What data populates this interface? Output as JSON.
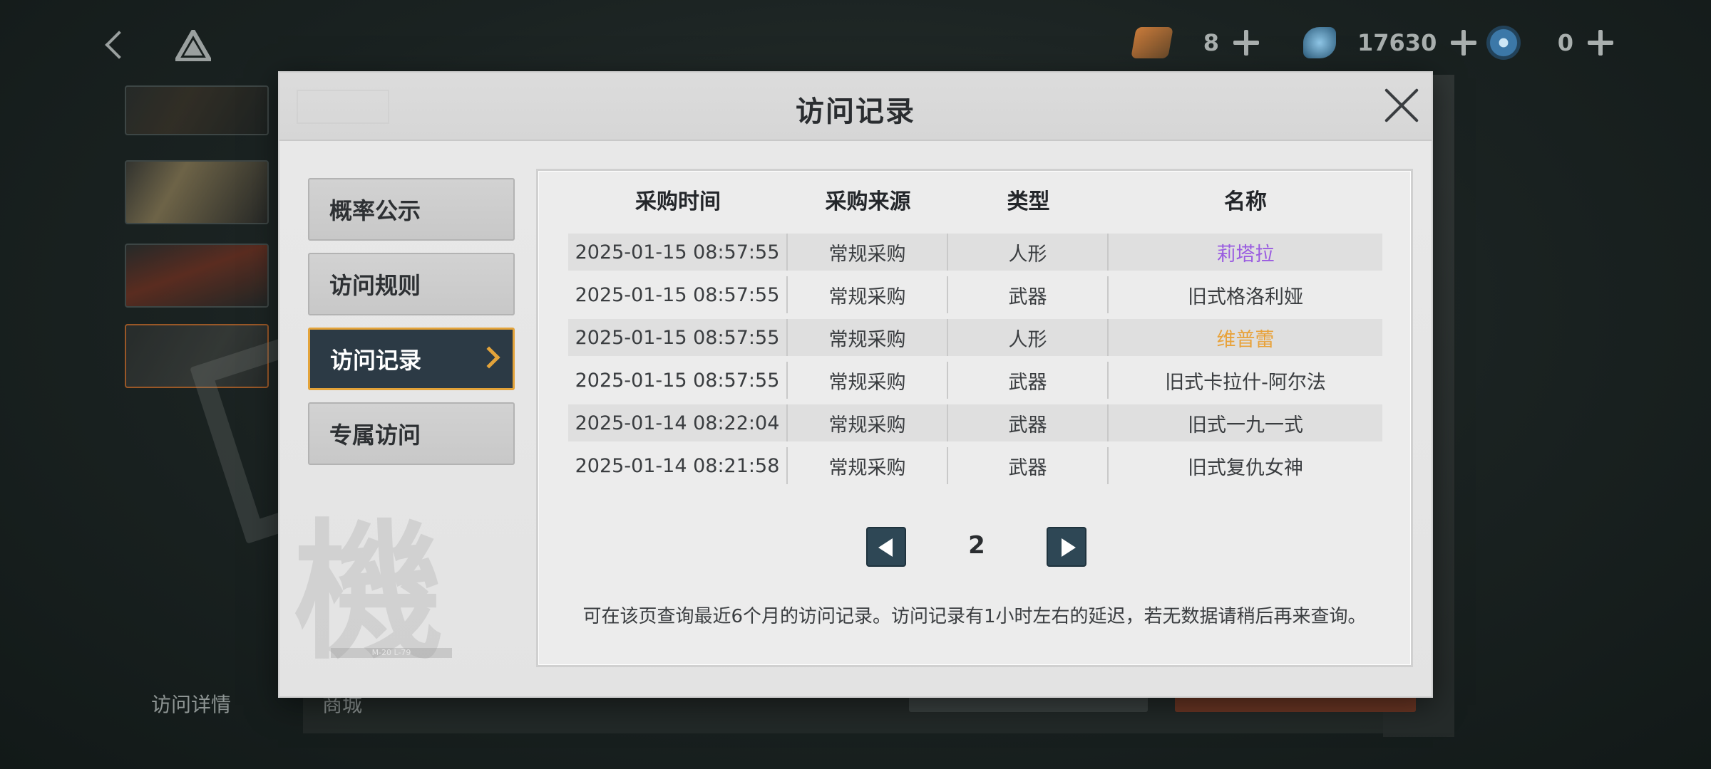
{
  "currencies": [
    {
      "icon": "ticket-icon",
      "value": "8"
    },
    {
      "icon": "crystal-icon",
      "value": "17630"
    },
    {
      "icon": "token-icon",
      "value": "0"
    }
  ],
  "modal": {
    "title": "访问记录"
  },
  "sidebar": {
    "items": [
      {
        "label": "概率公示"
      },
      {
        "label": "访问规则"
      },
      {
        "label": "访问记录",
        "active": true
      },
      {
        "label": "专属访问"
      }
    ]
  },
  "table": {
    "headers": [
      "采购时间",
      "采购来源",
      "类型",
      "名称"
    ],
    "rows": [
      {
        "time": "2025-01-15 08:57:55",
        "source": "常规采购",
        "type": "人形",
        "name": "莉塔拉",
        "name_color": "#9a5ce0"
      },
      {
        "time": "2025-01-15 08:57:55",
        "source": "常规采购",
        "type": "武器",
        "name": "旧式格洛利娅",
        "name_color": "#3a3d40"
      },
      {
        "time": "2025-01-15 08:57:55",
        "source": "常规采购",
        "type": "人形",
        "name": "维普蕾",
        "name_color": "#e8a23a"
      },
      {
        "time": "2025-01-15 08:57:55",
        "source": "常规采购",
        "type": "武器",
        "name": "旧式卡拉什-阿尔法",
        "name_color": "#3a3d40"
      },
      {
        "time": "2025-01-14 08:22:04",
        "source": "常规采购",
        "type": "武器",
        "name": "旧式一九一式",
        "name_color": "#3a3d40"
      },
      {
        "time": "2025-01-14 08:21:58",
        "source": "常规采购",
        "type": "武器",
        "name": "旧式复仇女神",
        "name_color": "#3a3d40"
      }
    ]
  },
  "pager": {
    "page": "2"
  },
  "footnote": "可在该页查询最近6个月的访问记录。访问记录有1小时左右的延迟，若无数据请稍后再来查询。",
  "bottom_tabs": [
    "访问详情",
    "商城"
  ],
  "decor": {
    "kanji": "機",
    "band": "M-20 L-79",
    "stamp": "XANDRUM"
  },
  "colors": {
    "active_border": "#e3a33a",
    "active_bg": "#2c3a45",
    "pager_btn": "#2e4755"
  }
}
